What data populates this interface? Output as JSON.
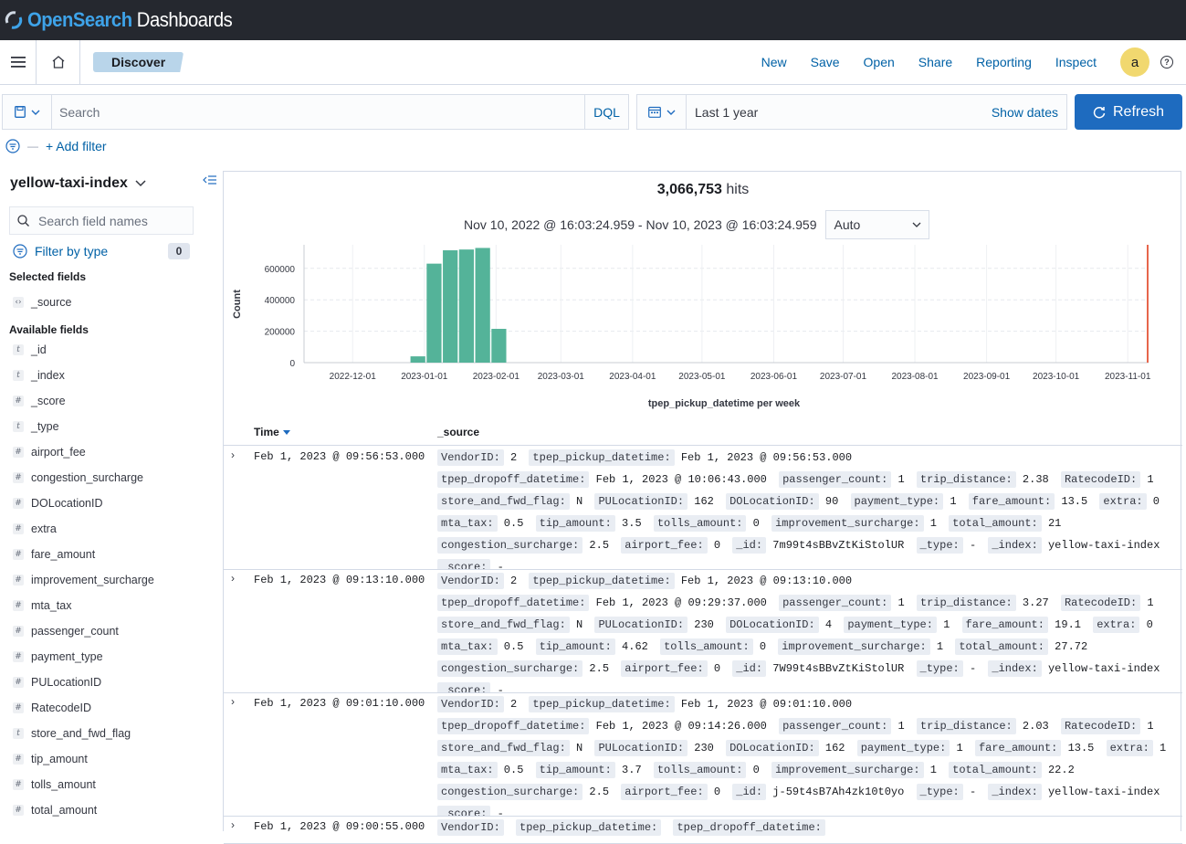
{
  "topbar": {
    "brand_part1": "OpenSearch",
    "brand_part2": " Dashboards"
  },
  "nav": {
    "breadcrumb": "Discover",
    "links": [
      "New",
      "Save",
      "Open",
      "Share",
      "Reporting",
      "Inspect"
    ],
    "avatar_letter": "a"
  },
  "query": {
    "placeholder": "Search",
    "language": "DQL"
  },
  "date": {
    "range": "Last 1 year",
    "show_dates": "Show dates",
    "refresh": "Refresh"
  },
  "filters": {
    "add_filter": "+ Add filter"
  },
  "sidebar": {
    "index_pattern": "yellow-taxi-index",
    "field_search_placeholder": "Search field names",
    "filter_by_type": "Filter by type",
    "filter_count": "0",
    "selected_title": "Selected fields",
    "selected": [
      {
        "name": "_source",
        "type": "source"
      }
    ],
    "available_title": "Available fields",
    "available": [
      {
        "name": "_id",
        "type": "t"
      },
      {
        "name": "_index",
        "type": "t"
      },
      {
        "name": "_score",
        "type": "#"
      },
      {
        "name": "_type",
        "type": "t"
      },
      {
        "name": "airport_fee",
        "type": "#"
      },
      {
        "name": "congestion_surcharge",
        "type": "#"
      },
      {
        "name": "DOLocationID",
        "type": "#"
      },
      {
        "name": "extra",
        "type": "#"
      },
      {
        "name": "fare_amount",
        "type": "#"
      },
      {
        "name": "improvement_surcharge",
        "type": "#"
      },
      {
        "name": "mta_tax",
        "type": "#"
      },
      {
        "name": "passenger_count",
        "type": "#"
      },
      {
        "name": "payment_type",
        "type": "#"
      },
      {
        "name": "PULocationID",
        "type": "#"
      },
      {
        "name": "RatecodeID",
        "type": "#"
      },
      {
        "name": "store_and_fwd_flag",
        "type": "t"
      },
      {
        "name": "tip_amount",
        "type": "#"
      },
      {
        "name": "tolls_amount",
        "type": "#"
      },
      {
        "name": "total_amount",
        "type": "#"
      }
    ]
  },
  "results": {
    "hits_count": "3,066,753",
    "hits_label": " hits",
    "time_range": "Nov 10, 2022 @ 16:03:24.959 - Nov 10, 2023 @ 16:03:24.959",
    "interval": "Auto",
    "col_time": "Time",
    "col_source": "_source"
  },
  "chart_data": {
    "type": "bar",
    "ylabel": "Count",
    "xlabel": "tpep_pickup_datetime per week",
    "ylim": [
      0,
      750000
    ],
    "yticks": [
      "0",
      "200000",
      "400000",
      "600000"
    ],
    "xticks": [
      "2022-12-01",
      "2023-01-01",
      "2023-02-01",
      "2023-03-01",
      "2023-04-01",
      "2023-05-01",
      "2023-06-01",
      "2023-07-01",
      "2023-08-01",
      "2023-09-01",
      "2023-10-01",
      "2023-11-01"
    ],
    "categories": [
      "2022-12-26",
      "2023-01-02",
      "2023-01-09",
      "2023-01-16",
      "2023-01-23",
      "2023-01-30"
    ],
    "values": [
      40000,
      630000,
      715000,
      720000,
      730000,
      215000
    ],
    "bar_color": "#54b399",
    "now_marker_color": "#e7664c"
  },
  "rows": [
    {
      "time": "Feb 1, 2023 @ 09:56:53.000",
      "fields": [
        [
          "VendorID:",
          "2"
        ],
        [
          "tpep_pickup_datetime:",
          "Feb 1, 2023 @ 09:56:53.000"
        ],
        [
          "tpep_dropoff_datetime:",
          "Feb 1, 2023 @ 10:06:43.000"
        ],
        [
          "passenger_count:",
          "1"
        ],
        [
          "trip_distance:",
          "2.38"
        ],
        [
          "RatecodeID:",
          "1"
        ],
        [
          "store_and_fwd_flag:",
          "N"
        ],
        [
          "PULocationID:",
          "162"
        ],
        [
          "DOLocationID:",
          "90"
        ],
        [
          "payment_type:",
          "1"
        ],
        [
          "fare_amount:",
          "13.5"
        ],
        [
          "extra:",
          "0"
        ],
        [
          "mta_tax:",
          "0.5"
        ],
        [
          "tip_amount:",
          "3.5"
        ],
        [
          "tolls_amount:",
          "0"
        ],
        [
          "improvement_surcharge:",
          "1"
        ],
        [
          "total_amount:",
          "21"
        ],
        [
          "congestion_surcharge:",
          "2.5"
        ],
        [
          "airport_fee:",
          "0"
        ],
        [
          "_id:",
          "7m99t4sBBvZtKiStolUR"
        ],
        [
          "_type:",
          "-"
        ],
        [
          "_index:",
          "yellow-taxi-index"
        ],
        [
          "_score:",
          "-"
        ]
      ]
    },
    {
      "time": "Feb 1, 2023 @ 09:13:10.000",
      "fields": [
        [
          "VendorID:",
          "2"
        ],
        [
          "tpep_pickup_datetime:",
          "Feb 1, 2023 @ 09:13:10.000"
        ],
        [
          "tpep_dropoff_datetime:",
          "Feb 1, 2023 @ 09:29:37.000"
        ],
        [
          "passenger_count:",
          "1"
        ],
        [
          "trip_distance:",
          "3.27"
        ],
        [
          "RatecodeID:",
          "1"
        ],
        [
          "store_and_fwd_flag:",
          "N"
        ],
        [
          "PULocationID:",
          "230"
        ],
        [
          "DOLocationID:",
          "4"
        ],
        [
          "payment_type:",
          "1"
        ],
        [
          "fare_amount:",
          "19.1"
        ],
        [
          "extra:",
          "0"
        ],
        [
          "mta_tax:",
          "0.5"
        ],
        [
          "tip_amount:",
          "4.62"
        ],
        [
          "tolls_amount:",
          "0"
        ],
        [
          "improvement_surcharge:",
          "1"
        ],
        [
          "total_amount:",
          "27.72"
        ],
        [
          "congestion_surcharge:",
          "2.5"
        ],
        [
          "airport_fee:",
          "0"
        ],
        [
          "_id:",
          "7W99t4sBBvZtKiStolUR"
        ],
        [
          "_type:",
          "-"
        ],
        [
          "_index:",
          "yellow-taxi-index"
        ],
        [
          "_score:",
          "-"
        ]
      ]
    },
    {
      "time": "Feb 1, 2023 @ 09:01:10.000",
      "fields": [
        [
          "VendorID:",
          "2"
        ],
        [
          "tpep_pickup_datetime:",
          "Feb 1, 2023 @ 09:01:10.000"
        ],
        [
          "tpep_dropoff_datetime:",
          "Feb 1, 2023 @ 09:14:26.000"
        ],
        [
          "passenger_count:",
          "1"
        ],
        [
          "trip_distance:",
          "2.03"
        ],
        [
          "RatecodeID:",
          "1"
        ],
        [
          "store_and_fwd_flag:",
          "N"
        ],
        [
          "PULocationID:",
          "230"
        ],
        [
          "DOLocationID:",
          "162"
        ],
        [
          "payment_type:",
          "1"
        ],
        [
          "fare_amount:",
          "13.5"
        ],
        [
          "extra:",
          "1"
        ],
        [
          "mta_tax:",
          "0.5"
        ],
        [
          "tip_amount:",
          "3.7"
        ],
        [
          "tolls_amount:",
          "0"
        ],
        [
          "improvement_surcharge:",
          "1"
        ],
        [
          "total_amount:",
          "22.2"
        ],
        [
          "congestion_surcharge:",
          "2.5"
        ],
        [
          "airport_fee:",
          "0"
        ],
        [
          "_id:",
          "j-59t4sB7Ah4zk10t0yo"
        ],
        [
          "_type:",
          "-"
        ],
        [
          "_index:",
          "yellow-taxi-index"
        ],
        [
          "_score:",
          "-"
        ]
      ]
    },
    {
      "time": "Feb 1, 2023 @ 09:00:55.000",
      "fields": [
        [
          "VendorID:",
          ""
        ],
        [
          "tpep_pickup_datetime:",
          ""
        ],
        [
          "tpep_dropoff_datetime:",
          ""
        ]
      ]
    }
  ]
}
